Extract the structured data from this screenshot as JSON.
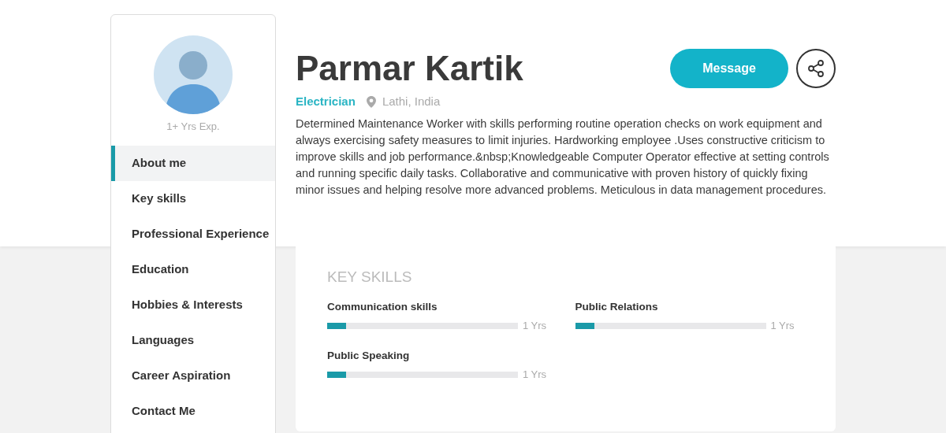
{
  "profile": {
    "experience": "1+ Yrs Exp.",
    "name": "Parmar Kartik",
    "role": "Electrician",
    "location": "Lathi, India",
    "summary": "Determined Maintenance Worker with skills performing routine operation checks on work equipment and always exercising safety measures to limit injuries. Hardworking employee .Uses constructive criticism to improve skills and job performance.&nbsp;Knowledgeable Computer Operator effective at setting controls and running specific daily tasks. Collaborative and communicative with proven history of quickly fixing minor issues and helping resolve more advanced problems. Meticulous in data management procedures.",
    "message_button": "Message"
  },
  "sidebar": {
    "items": [
      {
        "label": "About me",
        "selected": true
      },
      {
        "label": "Key skills",
        "selected": false
      },
      {
        "label": "Professional Experience",
        "selected": false
      },
      {
        "label": "Education",
        "selected": false
      },
      {
        "label": "Hobbies & Interests",
        "selected": false
      },
      {
        "label": "Languages",
        "selected": false
      },
      {
        "label": "Career Aspiration",
        "selected": false
      },
      {
        "label": "Contact Me",
        "selected": false
      }
    ]
  },
  "key_skills": {
    "title": "KEY SKILLS",
    "skills": [
      {
        "name": "Communication skills",
        "level": 0.1,
        "reading": "1 Yrs"
      },
      {
        "name": "Public Relations",
        "level": 0.1,
        "reading": "1 Yrs"
      },
      {
        "name": "Public Speaking",
        "level": 0.1,
        "reading": "1 Yrs"
      }
    ]
  }
}
